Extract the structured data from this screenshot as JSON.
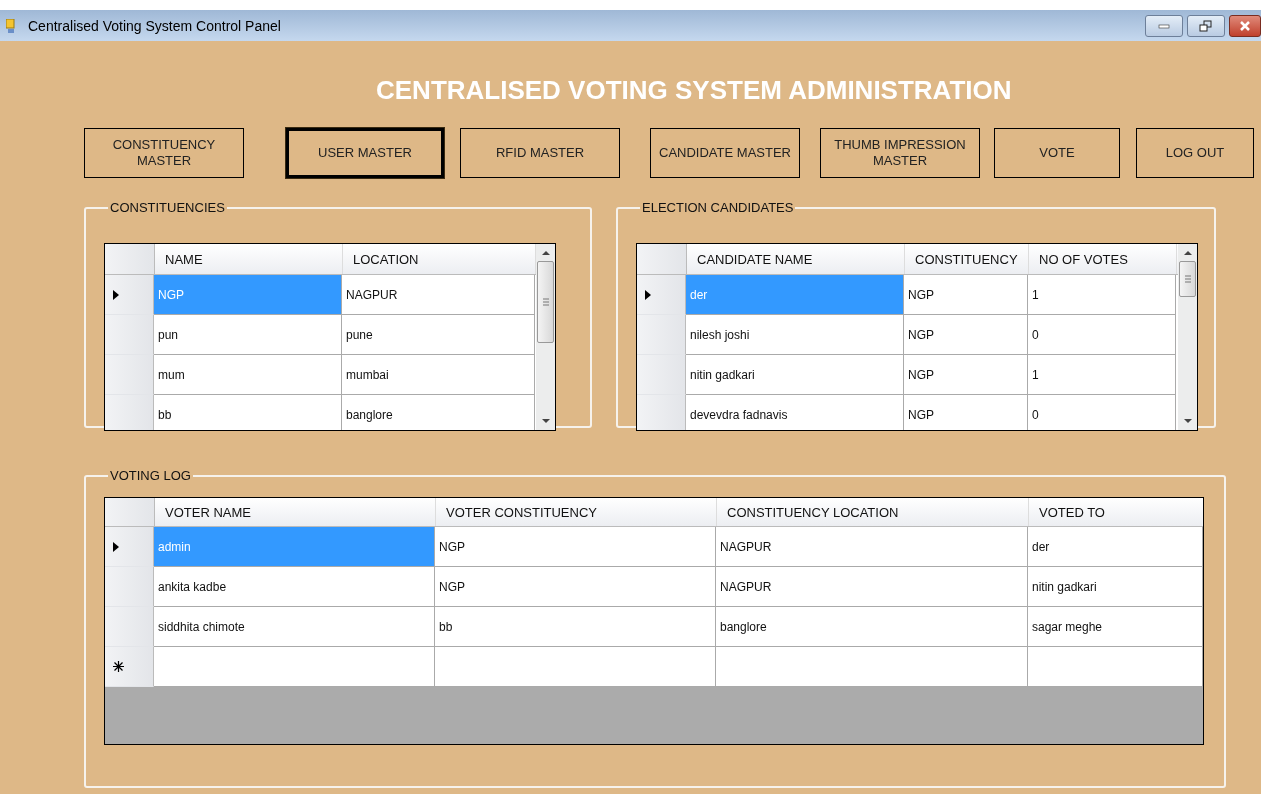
{
  "window": {
    "title": "Centralised Voting System Control Panel"
  },
  "heading": "CENTRALISED VOTING SYSTEM ADMINISTRATION",
  "buttons": [
    {
      "label": "CONSTITUENCY MASTER",
      "focused": false
    },
    {
      "label": "USER MASTER",
      "focused": true
    },
    {
      "label": "RFID MASTER",
      "focused": false
    },
    {
      "label": "CANDIDATE MASTER",
      "focused": false
    },
    {
      "label": "THUMB IMPRESSION MASTER",
      "focused": false
    },
    {
      "label": "VOTE",
      "focused": false
    },
    {
      "label": "LOG OUT",
      "focused": false
    }
  ],
  "constituencies": {
    "title": "CONSTITUENCIES",
    "columns": [
      "NAME",
      "LOCATION"
    ],
    "rows": [
      {
        "cells": [
          "NGP",
          "NAGPUR"
        ],
        "selected": true
      },
      {
        "cells": [
          "pun",
          "pune"
        ],
        "selected": false
      },
      {
        "cells": [
          "mum",
          "mumbai"
        ],
        "selected": false
      },
      {
        "cells": [
          "bb",
          "banglore"
        ],
        "selected": false
      }
    ]
  },
  "election_candidates": {
    "title": "ELECTION CANDIDATES",
    "columns": [
      "CANDIDATE NAME",
      "CONSTITUENCY",
      "NO OF VOTES"
    ],
    "rows": [
      {
        "cells": [
          "der",
          "NGP",
          "1"
        ],
        "selected": true
      },
      {
        "cells": [
          "nilesh joshi",
          "NGP",
          "0"
        ],
        "selected": false
      },
      {
        "cells": [
          "nitin gadkari",
          "NGP",
          "1"
        ],
        "selected": false
      },
      {
        "cells": [
          "devevdra fadnavis",
          "NGP",
          "0"
        ],
        "selected": false
      }
    ]
  },
  "voting_log": {
    "title": "VOTING LOG",
    "new_row": true,
    "columns": [
      "VOTER NAME",
      "VOTER CONSTITUENCY",
      "CONSTITUENCY LOCATION",
      "VOTED TO"
    ],
    "rows": [
      {
        "cells": [
          "admin",
          "NGP",
          "NAGPUR",
          "der"
        ],
        "selected": true
      },
      {
        "cells": [
          "ankita kadbe",
          "NGP",
          "NAGPUR",
          "nitin gadkari"
        ],
        "selected": false
      },
      {
        "cells": [
          "siddhita chimote",
          "bb",
          "banglore",
          "sagar meghe"
        ],
        "selected": false
      }
    ]
  }
}
